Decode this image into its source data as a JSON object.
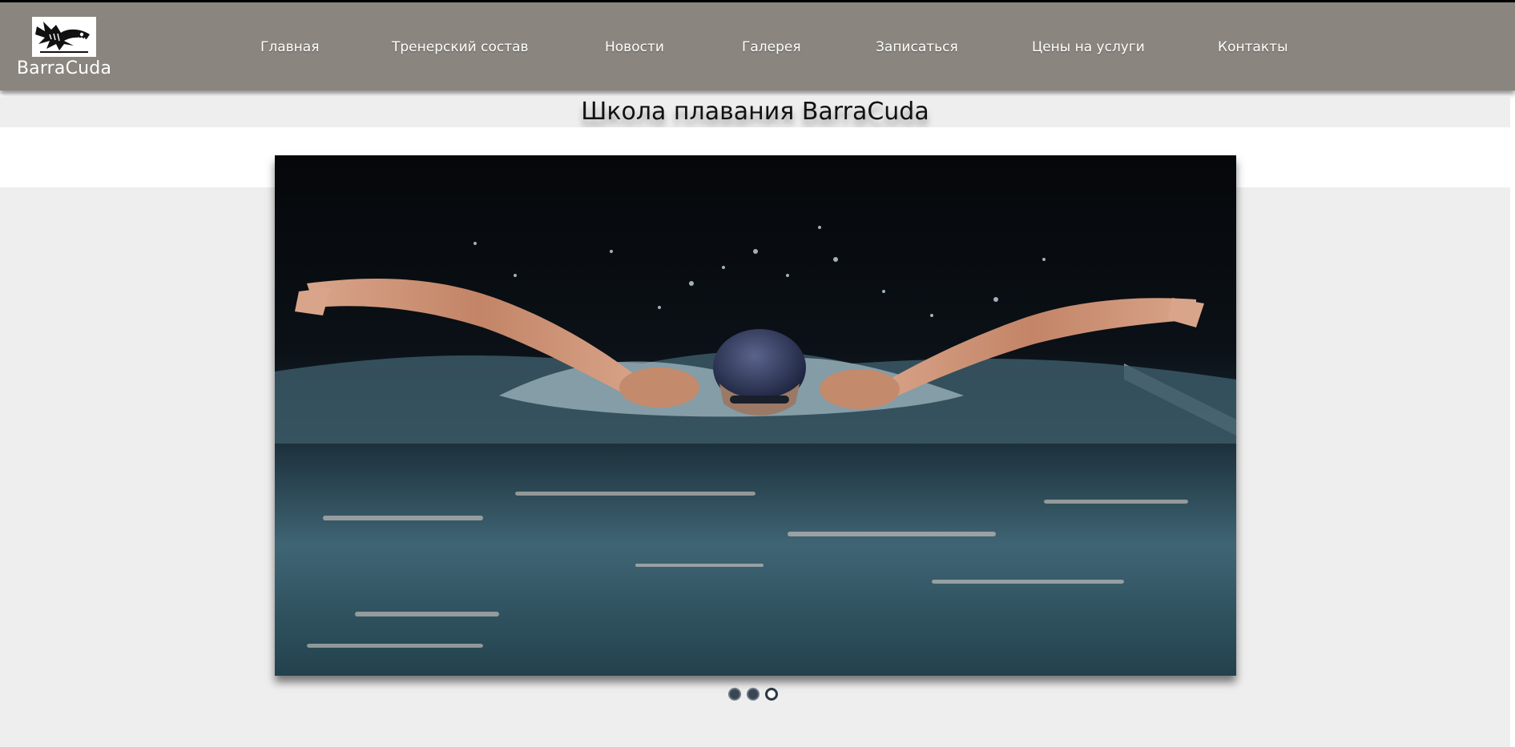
{
  "header": {
    "logo_text": "BarraCuda",
    "logo_icon": "barracuda-fish-logo",
    "background_color": "#8a857e"
  },
  "nav": {
    "items": [
      {
        "label": "Главная"
      },
      {
        "label": "Тренерский состав"
      },
      {
        "label": "Новости"
      },
      {
        "label": "Галерея"
      },
      {
        "label": "Записаться"
      },
      {
        "label": "Цены на услуги"
      },
      {
        "label": "Контакты"
      }
    ]
  },
  "main": {
    "title": "Школа плавания BarraCuda"
  },
  "slider": {
    "image": "butterfly-swimmer-photo",
    "slide_count": 3,
    "active_slide": 3
  }
}
